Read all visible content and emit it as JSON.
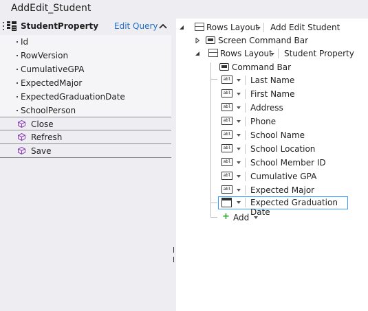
{
  "window": {
    "title": "AddEdit_Student"
  },
  "left_panel": {
    "entity": {
      "name": "StudentProperty",
      "edit_query_label": "Edit Query"
    },
    "fields": [
      "Id",
      "RowVersion",
      "CumulativeGPA",
      "ExpectedMajor",
      "ExpectedGraduationDate",
      "SchoolPerson"
    ],
    "methods": [
      "Close",
      "Refresh",
      "Save"
    ]
  },
  "tree": {
    "root": {
      "control": "Rows Layout",
      "label": "Add Edit Student"
    },
    "screen_command_bar": "Screen Command Bar",
    "group": {
      "control": "Rows Layout",
      "label": "Student Property"
    },
    "command_bar": "Command Bar",
    "items": [
      {
        "label": "Last Name",
        "icon": "abl-textbox-icon"
      },
      {
        "label": "First Name",
        "icon": "abl-textbox-icon"
      },
      {
        "label": "Address",
        "icon": "abl-textbox-icon"
      },
      {
        "label": "Phone",
        "icon": "abl-textbox-icon"
      },
      {
        "label": "School Name",
        "icon": "abl-textbox-icon"
      },
      {
        "label": "School Location",
        "icon": "abl-textbox-icon"
      },
      {
        "label": "School Member ID",
        "icon": "abl-textbox-icon"
      },
      {
        "label": "Cumulative GPA",
        "icon": "abl-textbox-icon"
      },
      {
        "label": "Expected Major",
        "icon": "abl-textbox-icon"
      },
      {
        "label": "Expected Graduation Date",
        "icon": "date-picker-icon",
        "selected": true
      }
    ],
    "add_label": "Add"
  },
  "colors": {
    "link": "#1e6ec8",
    "selection_border": "#3399ff",
    "add_plus": "#2a9d2a",
    "method_icon": "#8a3ab9"
  }
}
